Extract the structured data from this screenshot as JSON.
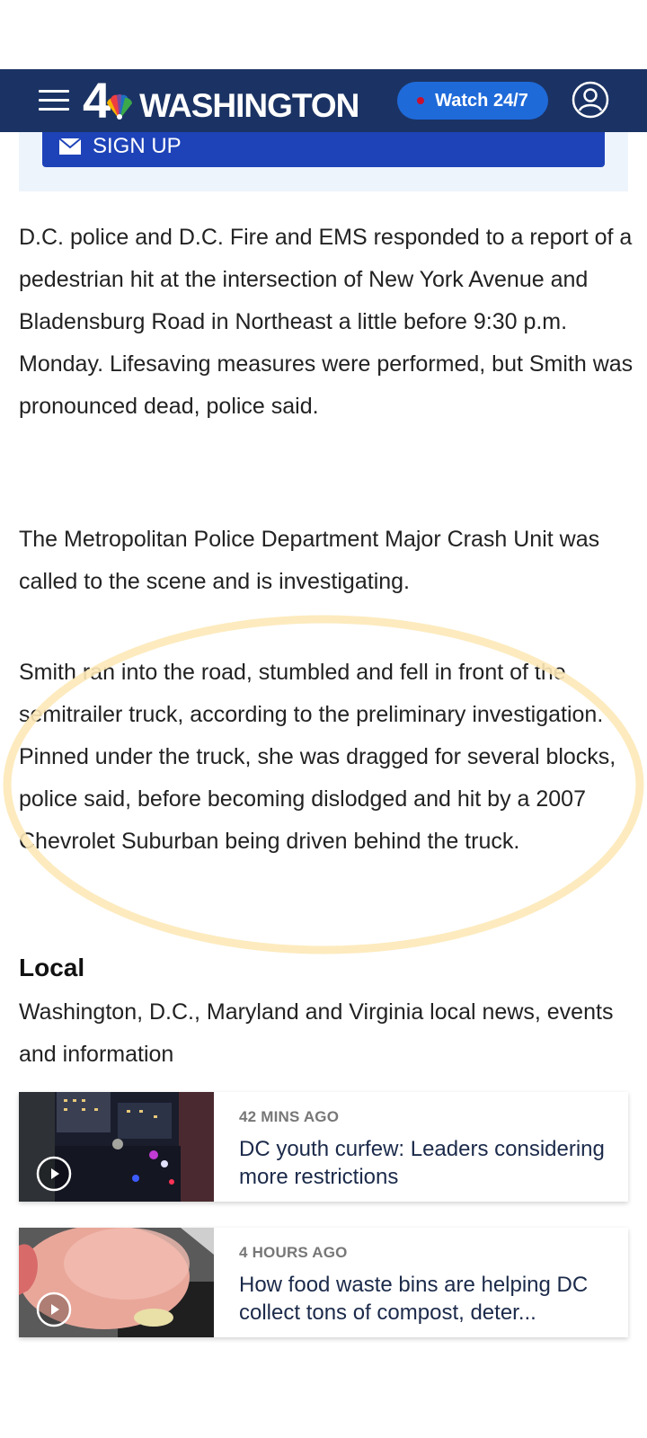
{
  "header": {
    "logo_number": "4",
    "logo_word": "WASHINGTON",
    "watch_label": "Watch 24/7",
    "colors": {
      "bar": "#1b3364",
      "watch_button": "#1f6ad9",
      "live_dot": "#c8102e"
    }
  },
  "newsletter": {
    "signup_label": "SIGN UP",
    "button_color": "#1e43b8"
  },
  "article": {
    "paragraphs": [
      "D.C. police and D.C. Fire and EMS responded to a report of a pedestrian hit at the intersection of New York Avenue and Bladensburg Road in Northeast a little before 9:30 p.m. Monday. Lifesaving measures were performed, but Smith was pronounced dead, police said.",
      "The Metropolitan Police Department Major Crash Unit was called to the scene and is investigating.",
      "Smith ran into the road, stumbled and fell in front of the semitrailer truck, according to the preliminary investigation. Pinned under the truck, she was dragged for several blocks, police said, before becoming dislodged and hit by a 2007 Chevrolet Suburban being driven behind the truck."
    ],
    "highlight_color": "#fde9b8"
  },
  "local": {
    "heading": "Local",
    "description": "Washington, D.C., Maryland and Virginia local news, events and information",
    "stories": [
      {
        "time": "42 MINS AGO",
        "title": "DC youth curfew: Leaders considering more restrictions",
        "icon": "play-icon"
      },
      {
        "time": "4 HOURS AGO",
        "title": "How food waste bins are helping DC collect tons of compost, deter...",
        "icon": "play-icon"
      }
    ]
  }
}
